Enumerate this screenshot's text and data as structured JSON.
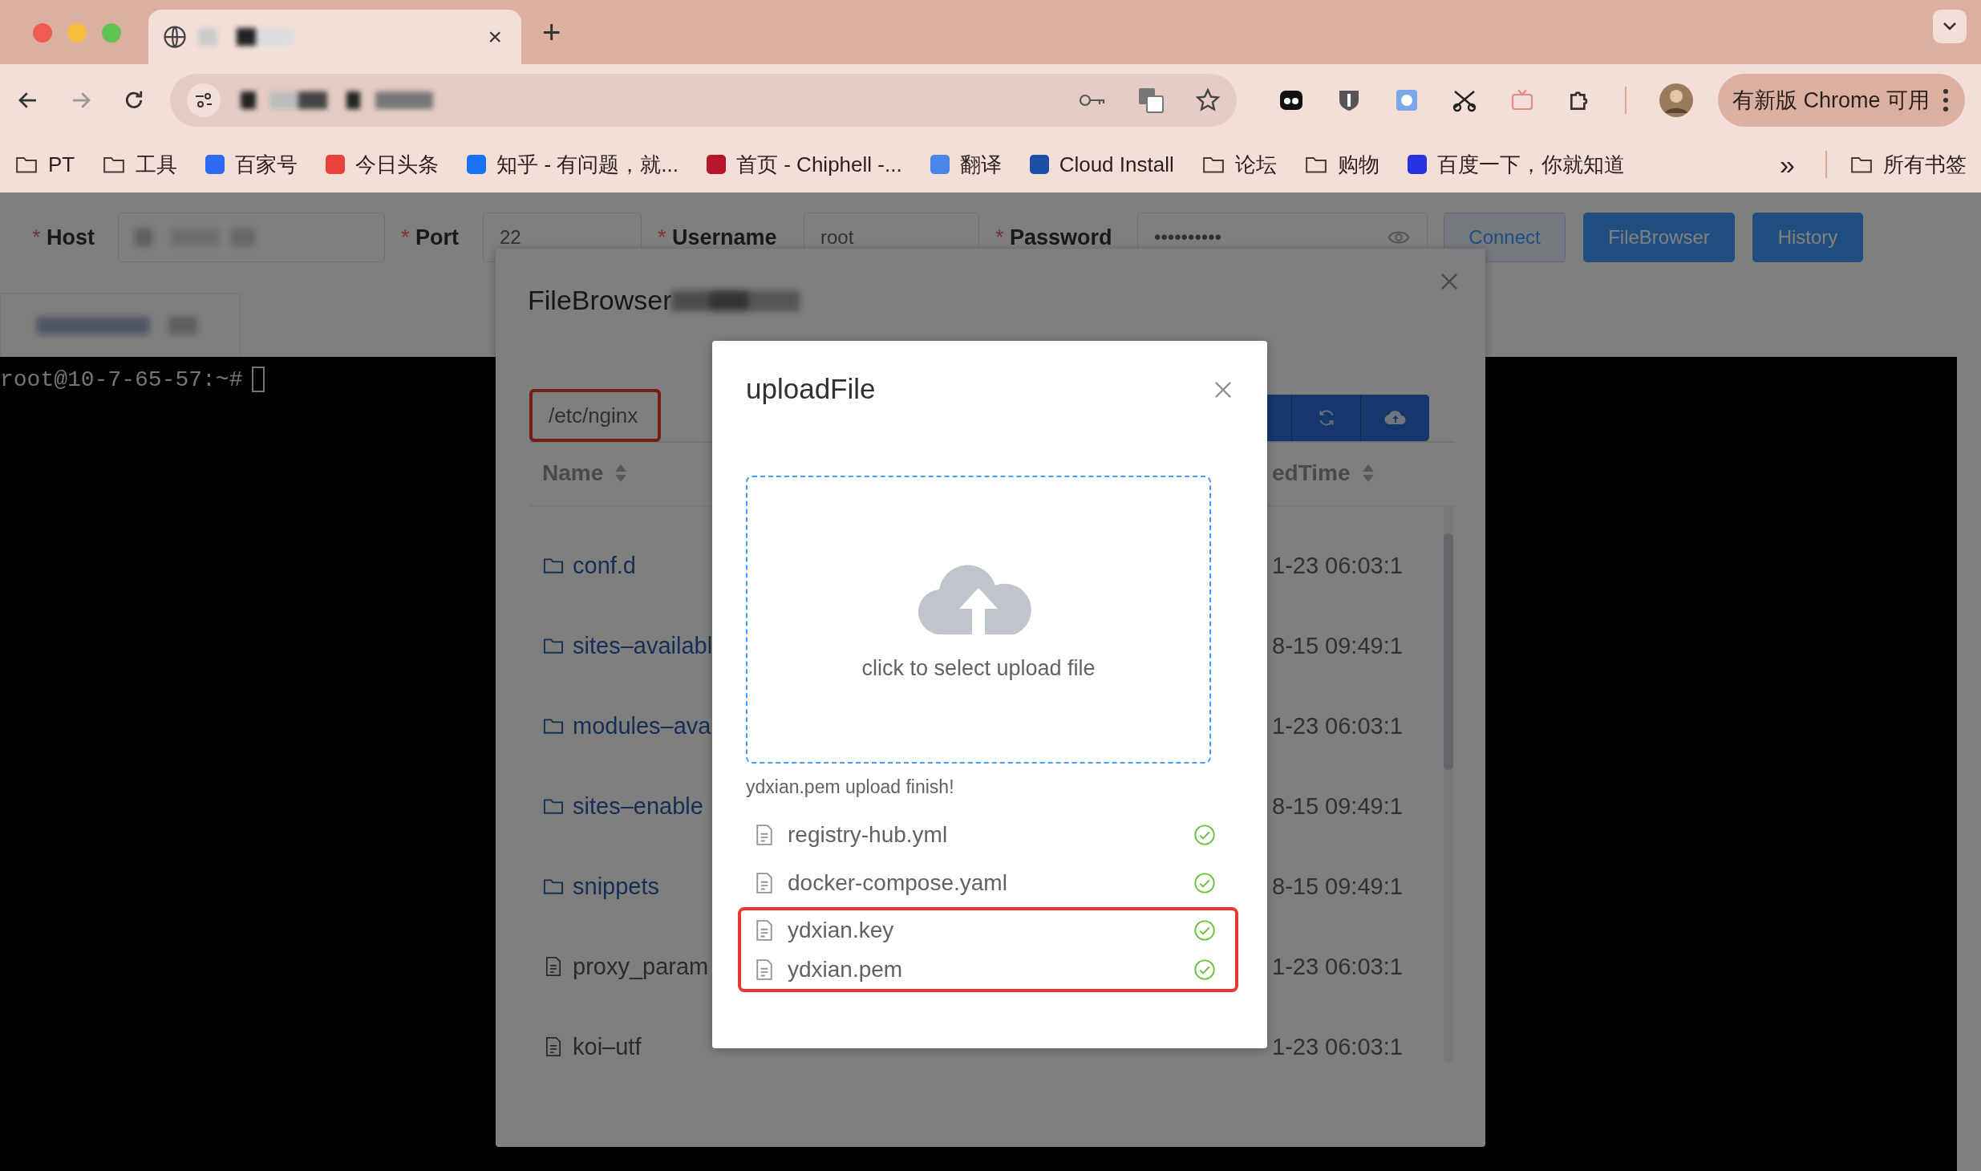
{
  "browser": {
    "tab_close": "×",
    "new_tab": "+",
    "update_button": "有新版 Chrome 可用",
    "bookmarks": [
      {
        "label": "PT",
        "kind": "folder"
      },
      {
        "label": "工具",
        "kind": "folder"
      },
      {
        "label": "百家号",
        "kind": "site",
        "color": "#2f6cf6"
      },
      {
        "label": "今日头条",
        "kind": "site",
        "color": "#e8433a"
      },
      {
        "label": "知乎 - 有问题，就...",
        "kind": "site",
        "color": "#1772f6"
      },
      {
        "label": "首页 - Chiphell -...",
        "kind": "site",
        "color": "#b5172b"
      },
      {
        "label": "翻译",
        "kind": "site",
        "color": "#4a86e8"
      },
      {
        "label": "Cloud Install",
        "kind": "site",
        "color": "#1c4fa8"
      },
      {
        "label": "论坛",
        "kind": "folder"
      },
      {
        "label": "购物",
        "kind": "folder"
      },
      {
        "label": "百度一下，你就知道",
        "kind": "site",
        "color": "#2932e1"
      }
    ],
    "more_bookmarks": "»",
    "all_bookmarks": "所有书签"
  },
  "connection_form": {
    "fields": [
      {
        "label": "Host",
        "required_mark": "*",
        "kind": "text"
      },
      {
        "label": "Port",
        "required_mark": "*",
        "kind": "text",
        "value": "22"
      },
      {
        "label": "Username",
        "required_mark": "*",
        "kind": "text",
        "value": "root"
      },
      {
        "label": "Password",
        "required_mark": "*",
        "kind": "password",
        "value": "••••••••••"
      }
    ],
    "buttons": [
      {
        "label": "Connect",
        "kind": "outline"
      },
      {
        "label": "FileBrowser",
        "kind": "primary"
      },
      {
        "label": "History",
        "kind": "primary"
      }
    ]
  },
  "terminal": {
    "prompt": "root@10-7-65-57:~#"
  },
  "file_browser": {
    "title": "FileBrowser",
    "path": "/etc/nginx",
    "path_highlighted": true,
    "columns": [
      "Name",
      "edTime"
    ],
    "rows": [
      {
        "name": "conf.d",
        "kind": "folder",
        "time": "1-23 06:03:1"
      },
      {
        "name": "sites–availabl",
        "kind": "folder",
        "time": "8-15 09:49:1"
      },
      {
        "name": "modules–ava",
        "kind": "folder",
        "time": "1-23 06:03:1"
      },
      {
        "name": "sites–enable",
        "kind": "folder",
        "time": "8-15 09:49:1"
      },
      {
        "name": "snippets",
        "kind": "folder",
        "time": "8-15 09:49:1"
      },
      {
        "name": "proxy_param",
        "kind": "file",
        "time": "1-23 06:03:1"
      },
      {
        "name": "koi–utf",
        "kind": "file",
        "time": "1-23 06:03:1"
      }
    ]
  },
  "upload_dialog": {
    "title": "uploadFile",
    "drop_hint": "click to select upload file",
    "status": "ydxian.pem upload finish!",
    "files": [
      {
        "name": "registry-hub.yml",
        "done": true,
        "highlighted": false
      },
      {
        "name": "docker-compose.yaml",
        "done": true,
        "highlighted": false
      },
      {
        "name": "ydxian.key",
        "done": true,
        "highlighted": true
      },
      {
        "name": "ydxian.pem",
        "done": true,
        "highlighted": true
      }
    ]
  }
}
